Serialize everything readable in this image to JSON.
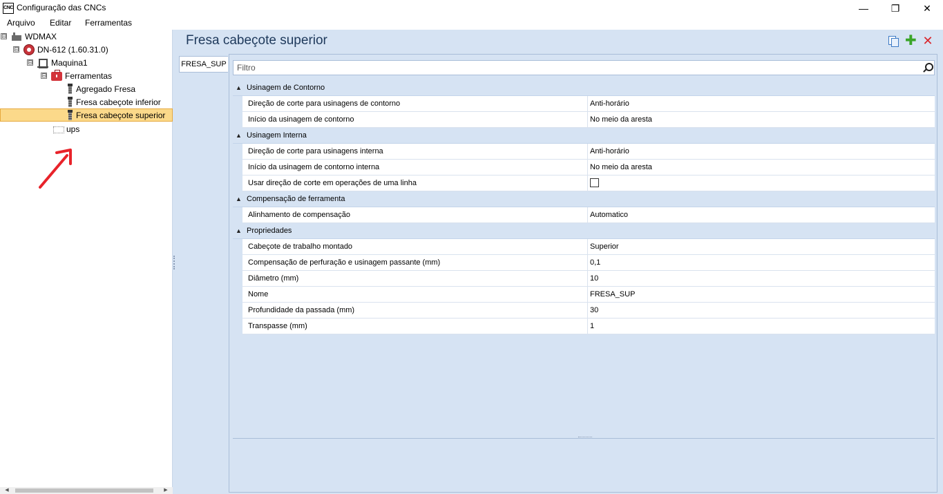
{
  "window": {
    "title": "Configuração das CNCs",
    "icon_label": "CNC",
    "minimize_glyph": "—",
    "maximize_glyph": "❐",
    "close_glyph": "✕"
  },
  "menu": {
    "items": [
      "Arquivo",
      "Editar",
      "Ferramentas"
    ]
  },
  "tree": {
    "root": {
      "label": "WDMAX",
      "icon": "factory-icon",
      "expander": "⊟"
    },
    "cnc": {
      "label": "DN-612 (1.60.31.0)",
      "icon": "cnc-icon",
      "expander": "⊟"
    },
    "machine": {
      "label": "Maquina1",
      "icon": "machine-icon",
      "expander": "⊟"
    },
    "tools_folder": {
      "label": "Ferramentas",
      "icon": "toolbox-icon",
      "expander": "⊟"
    },
    "tools": [
      {
        "label": "Agregado Fresa",
        "icon": "mill-tool-icon"
      },
      {
        "label": "Fresa cabeçote inferior",
        "icon": "mill-tool-icon"
      },
      {
        "label": "Fresa cabeçote superior",
        "icon": "mill-tool-icon",
        "selected": true
      }
    ],
    "groups": {
      "label": "ups",
      "icon": "groups-icon"
    }
  },
  "panel": {
    "title": "Fresa cabeçote superior",
    "side_tab": "FRESA_SUP",
    "filter_placeholder": "Filtro",
    "icons": [
      "copy-icon",
      "add-icon",
      "delete-icon"
    ],
    "add_glyph": "✚",
    "delete_glyph": "✕"
  },
  "properties": {
    "categories": [
      {
        "name": "Usinagem de Contorno",
        "rows": [
          {
            "name": "Direção de corte para usinagens de contorno",
            "value": "Anti-horário"
          },
          {
            "name": "Início da usinagem de contorno",
            "value": "No meio da aresta"
          }
        ]
      },
      {
        "name": "Usinagem Interna",
        "rows": [
          {
            "name": "Direção de corte para usinagens interna",
            "value": "Anti-horário"
          },
          {
            "name": "Início da usinagem de contorno interna",
            "value": "No meio da aresta"
          },
          {
            "name": "Usar direção de corte em operações de uma linha",
            "value": "",
            "checkbox": false
          }
        ]
      },
      {
        "name": "Compensação de ferramenta",
        "rows": [
          {
            "name": "Alinhamento de compensação",
            "value": "Automatico"
          }
        ]
      },
      {
        "name": "Propriedades",
        "rows": [
          {
            "name": "Cabeçote de trabalho montado",
            "value": "Superior"
          },
          {
            "name": "Compensação de perfuração e usinagem passante (mm)",
            "value": "0,1"
          },
          {
            "name": "Diâmetro (mm)",
            "value": "10"
          },
          {
            "name": "Nome",
            "value": "FRESA_SUP"
          },
          {
            "name": "Profundidade da passada (mm)",
            "value": "30"
          },
          {
            "name": "Transpasse (mm)",
            "value": "1"
          }
        ]
      }
    ]
  },
  "colors": {
    "panel_bg": "#d6e3f3",
    "title_text": "#1e395b",
    "selection_bg": "#fbd98a",
    "annotation_arrow": "#e8232a"
  }
}
